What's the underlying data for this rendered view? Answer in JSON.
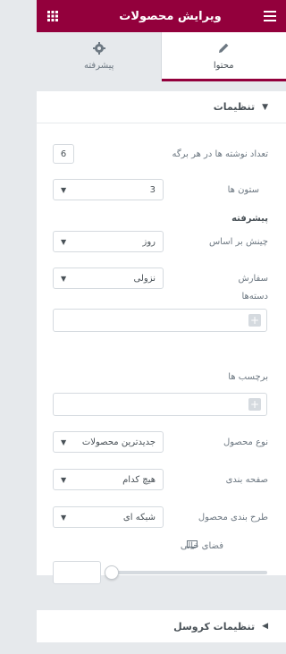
{
  "header": {
    "title": "ویرایش محصولات",
    "menu_icon": "hamburger-icon",
    "grid_icon": "grid-icon"
  },
  "tabs": [
    {
      "label": "محتوا",
      "icon": "pencil-icon",
      "active": true
    },
    {
      "label": "پیشرفته",
      "icon": "gear-icon",
      "active": false
    }
  ],
  "settings": {
    "section_title": "تنظیمات",
    "posts_per_page": {
      "label": "تعداد نوشته ها در هر برگه",
      "value": "6"
    },
    "columns": {
      "label": "ستون ها",
      "value": "3"
    },
    "advanced_heading": "پیشرفته",
    "order_by": {
      "label": "چینش بر اساس",
      "value": "روز"
    },
    "order": {
      "label": "سفارش",
      "value": "نزولی"
    },
    "categories": {
      "label": "دسته‌ها"
    },
    "tags": {
      "label": "برچسب ها"
    },
    "product_type": {
      "label": "نوع محصول",
      "value": "جدیدترین محصولات"
    },
    "pagination": {
      "label": "صفحه بندی",
      "value": "هیچ کدام"
    },
    "layout": {
      "label": "طرح بندی محصول",
      "value": "شبکه ای"
    },
    "gap": {
      "label": "فضای خالی"
    }
  },
  "carousel": {
    "title": "تنظیمات کروسل"
  },
  "colors": {
    "brand": "#93003c",
    "panel": "#ffffff",
    "background": "#e6e9ec"
  }
}
